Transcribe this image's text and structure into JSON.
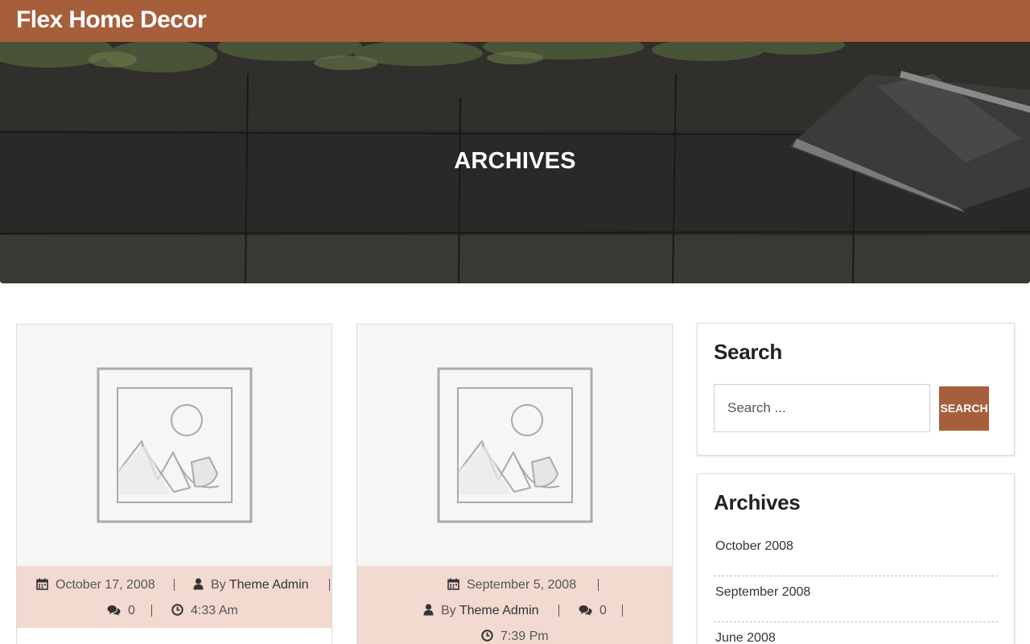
{
  "site": {
    "title": "Flex Home Decor"
  },
  "hero": {
    "title": "ARCHIVES"
  },
  "posts": [
    {
      "date": "October 17, 2008",
      "by": "By",
      "author": "Theme Admin",
      "comments": "0",
      "time": "4:33 Am"
    },
    {
      "date": "September 5, 2008",
      "by": "By",
      "author": "Theme Admin",
      "comments": "0",
      "time": "7:39 Pm"
    }
  ],
  "sidebar": {
    "search": {
      "title": "Search",
      "placeholder": "Search ...",
      "button": "SEARCH"
    },
    "archives": {
      "title": "Archives",
      "items": [
        "October 2008",
        "September 2008",
        "June 2008"
      ]
    }
  },
  "colors": {
    "accent": "#a65f3a",
    "meta_bg": "#f2dad1"
  }
}
